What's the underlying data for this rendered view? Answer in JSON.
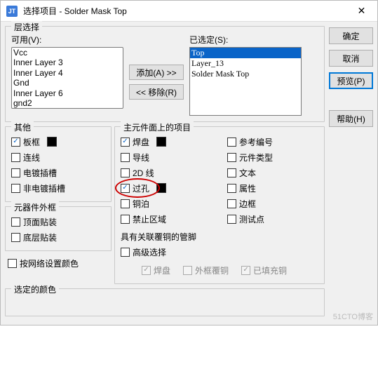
{
  "title": "选择项目 - Solder Mask Top",
  "app_icon_text": "JT",
  "close_glyph": "✕",
  "buttons": {
    "ok": "确定",
    "cancel": "取消",
    "preview": "预览(P)",
    "help": "帮助(H)",
    "add": "添加(A) >>",
    "remove": "<< 移除(R)"
  },
  "layer_select": {
    "legend": "层选择",
    "available_label": "可用(V):",
    "selected_label": "已选定(S):",
    "available": [
      "Vcc",
      "Inner Layer 3",
      "Inner Layer 4",
      "Gnd",
      "Inner Layer 6",
      "gnd2"
    ],
    "selected": [
      "Top",
      "Layer_13",
      "Solder Mask Top"
    ],
    "selected_index": 0
  },
  "other": {
    "legend": "其他",
    "items": [
      {
        "label": "板框",
        "checked": true,
        "swatch": true
      },
      {
        "label": "连线",
        "checked": false
      },
      {
        "label": "电镀插槽",
        "checked": false
      },
      {
        "label": "非电镀插槽",
        "checked": false
      }
    ]
  },
  "comp_outline": {
    "legend": "元器件外框",
    "items": [
      {
        "label": "顶面贴装",
        "checked": false
      },
      {
        "label": "底层贴装",
        "checked": false
      }
    ]
  },
  "main_items": {
    "legend": "主元件面上的项目",
    "left": [
      {
        "label": "焊盘",
        "checked": true,
        "swatch": true
      },
      {
        "label": "导线",
        "checked": false
      },
      {
        "label": "2D 线",
        "checked": false
      },
      {
        "label": "过孔",
        "checked": true,
        "swatch": true,
        "highlight": true
      },
      {
        "label": "铜泊",
        "checked": false
      },
      {
        "label": "禁止区域",
        "checked": false
      }
    ],
    "right": [
      {
        "label": "参考编号",
        "checked": false
      },
      {
        "label": "元件类型",
        "checked": false
      },
      {
        "label": "文本",
        "checked": false
      },
      {
        "label": "属性",
        "checked": false
      },
      {
        "label": "边框",
        "checked": false
      },
      {
        "label": "测试点",
        "checked": false
      }
    ],
    "assoc_label": "具有关联覆铜的管脚",
    "advanced": {
      "label": "高级选择",
      "checked": false
    },
    "sub": [
      {
        "label": "焊盘",
        "checked": true,
        "disabled": true
      },
      {
        "label": "外框覆铜",
        "checked": false,
        "disabled": true
      },
      {
        "label": "已填充铜",
        "checked": true,
        "disabled": true
      }
    ]
  },
  "net_colors": {
    "label": "按网络设置颜色",
    "checked": false
  },
  "selected_color": {
    "legend": "选定的颜色"
  },
  "watermark": "51CTO博客"
}
